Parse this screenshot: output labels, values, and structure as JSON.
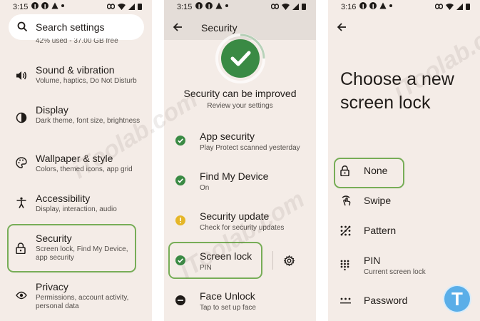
{
  "colors": {
    "panel_bg": "#f4ece7",
    "app_bar": "#e4ddd8",
    "highlight": "#77ad57",
    "check_green": "#3a8a44",
    "warning_yellow": "#e5b628",
    "logo_blue": "#5aaee8"
  },
  "panel1": {
    "status_time": "3:15",
    "search_placeholder": "Search settings",
    "clipped_text": "42% used - 37.00 GB free",
    "items": [
      {
        "title": "Sound & vibration",
        "sub": "Volume, haptics, Do Not Disturb",
        "icon": "speaker-icon"
      },
      {
        "title": "Display",
        "sub": "Dark theme, font size, brightness",
        "icon": "brightness-icon"
      },
      {
        "title": "Wallpaper & style",
        "sub": "Colors, themed icons, app grid",
        "icon": "palette-icon"
      },
      {
        "title": "Accessibility",
        "sub": "Display, interaction, audio",
        "icon": "accessibility-icon"
      },
      {
        "title": "Security",
        "sub": "Screen lock, Find My Device, app security",
        "icon": "lock-icon"
      },
      {
        "title": "Privacy",
        "sub": "Permissions, account activity, personal data",
        "icon": "eye-icon"
      }
    ]
  },
  "panel2": {
    "status_time": "3:15",
    "title": "Security",
    "headline": "Security can be improved",
    "subline": "Review your settings",
    "items": [
      {
        "title": "App security",
        "sub": "Play Protect scanned yesterday",
        "status": "check-circle-icon"
      },
      {
        "title": "Find My Device",
        "sub": "On",
        "status": "check-circle-icon"
      },
      {
        "title": "Security update",
        "sub": "Check for security updates",
        "status": "warning-circle-icon"
      },
      {
        "title": "Screen lock",
        "sub": "PIN",
        "status": "check-circle-icon"
      },
      {
        "title": "Face Unlock",
        "sub": "Tap to set up face",
        "status": "minus-circle-icon"
      }
    ]
  },
  "panel3": {
    "status_time": "3:16",
    "title_line1": "Choose a new",
    "title_line2": "screen lock",
    "options": [
      {
        "title": "None",
        "sub": "",
        "icon": "lock-open-icon"
      },
      {
        "title": "Swipe",
        "sub": "",
        "icon": "swipe-icon"
      },
      {
        "title": "Pattern",
        "sub": "",
        "icon": "pattern-icon"
      },
      {
        "title": "PIN",
        "sub": "Current screen lock",
        "icon": "pin-icon"
      },
      {
        "title": "Password",
        "sub": "",
        "icon": "password-icon"
      }
    ]
  },
  "watermark_text": "iToolab.com",
  "logo_letter": "T"
}
